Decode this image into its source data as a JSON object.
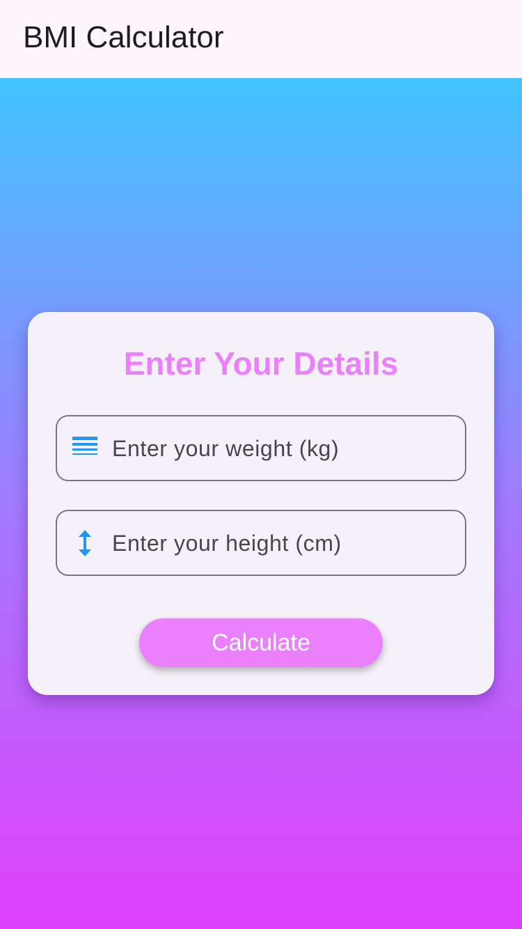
{
  "app_bar": {
    "title": "BMI Calculator",
    "background": "#fdf6fc"
  },
  "background": {
    "gradient_top": "#40c4ff",
    "gradient_bottom": "#e040fb"
  },
  "card": {
    "title": "Enter Your Details",
    "title_color": "#ea80fc"
  },
  "form": {
    "weight": {
      "placeholder": "Enter your weight (kg)",
      "value": "",
      "icon": "line-weight-icon"
    },
    "height": {
      "placeholder": "Enter your height (cm)",
      "value": "",
      "icon": "vertical-arrows-icon"
    },
    "icon_color": "#2196f3"
  },
  "actions": {
    "calculate_label": "Calculate",
    "button_color": "#ea80fc"
  }
}
